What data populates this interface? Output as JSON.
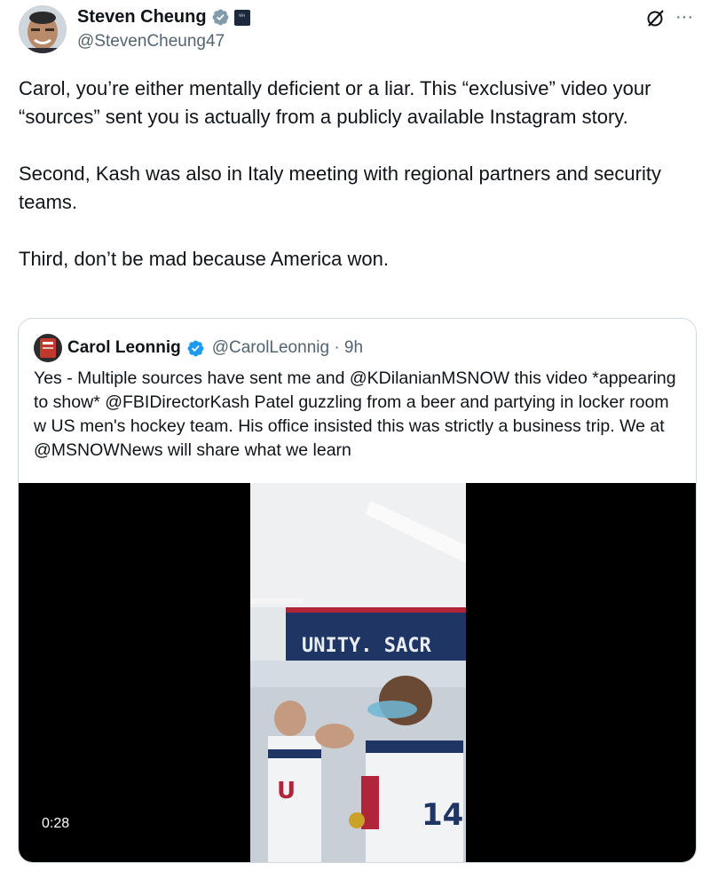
{
  "author": {
    "name": "Steven Cheung",
    "handle": "@StevenCheung47",
    "verified_color": "#829aab",
    "affiliate_badge_text": "WH"
  },
  "header_icons": {
    "grok": "grok-icon",
    "more": "more-options-icon",
    "more_glyph": "···"
  },
  "tweet": {
    "paragraphs": [
      "Carol, you’re either mentally deficient or a liar. This “exclusive” video your “sources” sent you is actually from a publicly available Instagram story.",
      "Second, Kash was also in Italy meeting with regional partners and security teams.",
      "Third, don’t be mad because America won."
    ]
  },
  "quote": {
    "name": "Carol Leonnig",
    "handle_time": "@CarolLeonnig · 9h",
    "verified_color": "#1d9bf0",
    "text": "Yes - Multiple sources have sent me and @KDilanianMSNOW this video *appearing to show* @FBIDirectorKash Patel guzzling from a beer and partying in locker room w US men's hockey team. His office insisted this was strictly a business trip. We at @MSNOWNews will share what we learn",
    "video": {
      "duration": "0:28",
      "banner_text": "UNITY. SACR",
      "jersey_number": "14",
      "jersey_letter": "U"
    }
  }
}
